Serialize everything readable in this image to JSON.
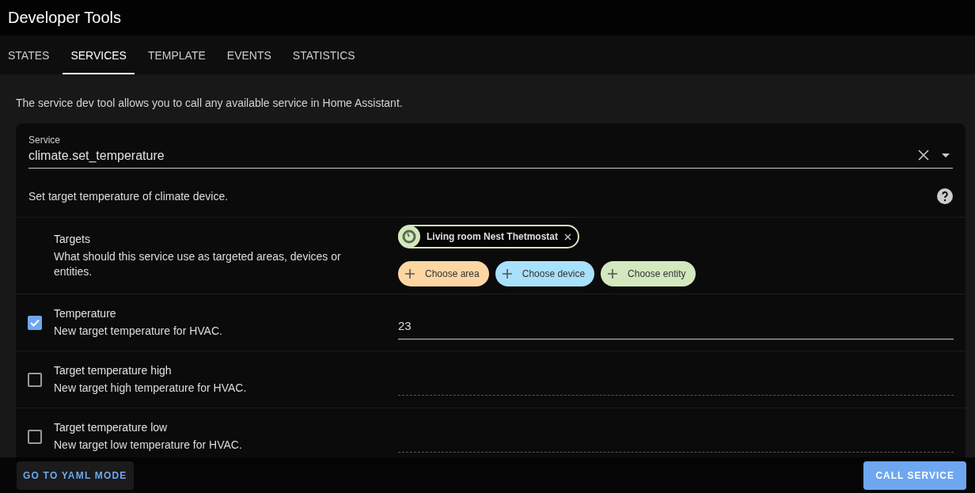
{
  "header": {
    "title": "Developer Tools"
  },
  "tabs": [
    {
      "label": "STATES",
      "selected": false
    },
    {
      "label": "SERVICES",
      "selected": true
    },
    {
      "label": "TEMPLATE",
      "selected": false
    },
    {
      "label": "EVENTS",
      "selected": false
    },
    {
      "label": "STATISTICS",
      "selected": false
    }
  ],
  "intro": "The service dev tool allows you to call any available service in Home Assistant.",
  "service": {
    "label": "Service",
    "value": "climate.set_temperature",
    "description": "Set target temperature of climate device."
  },
  "rows": [
    {
      "kind": "targets",
      "name": "Targets",
      "description": "What should this service use as targeted areas, devices or entities.",
      "chips": [
        {
          "label": "Living room Nest Thetmostat",
          "color": "#d4e8be"
        }
      ],
      "add_buttons": [
        {
          "label": "Choose area",
          "color": "#fed6a4"
        },
        {
          "label": "Choose device",
          "color": "#a8e1fb"
        },
        {
          "label": "Choose entity",
          "color": "#d4e8be"
        }
      ]
    },
    {
      "kind": "field",
      "name": "Temperature",
      "description": "New target temperature for HVAC.",
      "checked": true,
      "value": "23"
    },
    {
      "kind": "field",
      "name": "Target temperature high",
      "description": "New target high temperature for HVAC.",
      "checked": false
    },
    {
      "kind": "field",
      "name": "Target temperature low",
      "description": "New target low temperature for HVAC.",
      "checked": false
    }
  ],
  "footer": {
    "left_button": "GO TO YAML MODE",
    "right_button": "CALL SERVICE"
  }
}
